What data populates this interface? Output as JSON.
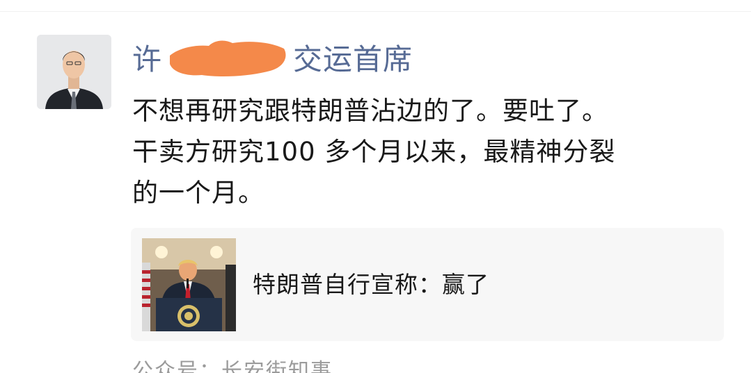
{
  "post": {
    "author_visible_start": "许",
    "author_visible_end": "交运首席",
    "lines": [
      "不想再研究跟特朗普沾边的了。要吐了。",
      "干卖方研究100 多个月以来，最精神分裂",
      "的一个月。"
    ]
  },
  "link_card": {
    "title": "特朗普自行宣称：赢了"
  },
  "source": {
    "label": "公众号：长安街知事"
  },
  "colors": {
    "author_name": "#576b95",
    "redaction": "#f4894a",
    "card_background": "#f7f7f7",
    "source_text": "#9b9b9b"
  },
  "icons": {
    "avatar": "user-avatar-photo",
    "thumbnail": "news-thumbnail-photo",
    "redaction": "orange-scribble"
  }
}
